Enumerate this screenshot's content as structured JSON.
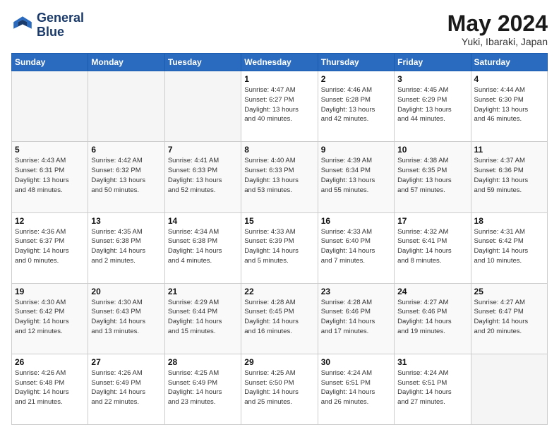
{
  "header": {
    "logo_line1": "General",
    "logo_line2": "Blue",
    "month_title": "May 2024",
    "location": "Yuki, Ibaraki, Japan"
  },
  "weekdays": [
    "Sunday",
    "Monday",
    "Tuesday",
    "Wednesday",
    "Thursday",
    "Friday",
    "Saturday"
  ],
  "weeks": [
    [
      {
        "day": "",
        "info": ""
      },
      {
        "day": "",
        "info": ""
      },
      {
        "day": "",
        "info": ""
      },
      {
        "day": "1",
        "info": "Sunrise: 4:47 AM\nSunset: 6:27 PM\nDaylight: 13 hours\nand 40 minutes."
      },
      {
        "day": "2",
        "info": "Sunrise: 4:46 AM\nSunset: 6:28 PM\nDaylight: 13 hours\nand 42 minutes."
      },
      {
        "day": "3",
        "info": "Sunrise: 4:45 AM\nSunset: 6:29 PM\nDaylight: 13 hours\nand 44 minutes."
      },
      {
        "day": "4",
        "info": "Sunrise: 4:44 AM\nSunset: 6:30 PM\nDaylight: 13 hours\nand 46 minutes."
      }
    ],
    [
      {
        "day": "5",
        "info": "Sunrise: 4:43 AM\nSunset: 6:31 PM\nDaylight: 13 hours\nand 48 minutes."
      },
      {
        "day": "6",
        "info": "Sunrise: 4:42 AM\nSunset: 6:32 PM\nDaylight: 13 hours\nand 50 minutes."
      },
      {
        "day": "7",
        "info": "Sunrise: 4:41 AM\nSunset: 6:33 PM\nDaylight: 13 hours\nand 52 minutes."
      },
      {
        "day": "8",
        "info": "Sunrise: 4:40 AM\nSunset: 6:33 PM\nDaylight: 13 hours\nand 53 minutes."
      },
      {
        "day": "9",
        "info": "Sunrise: 4:39 AM\nSunset: 6:34 PM\nDaylight: 13 hours\nand 55 minutes."
      },
      {
        "day": "10",
        "info": "Sunrise: 4:38 AM\nSunset: 6:35 PM\nDaylight: 13 hours\nand 57 minutes."
      },
      {
        "day": "11",
        "info": "Sunrise: 4:37 AM\nSunset: 6:36 PM\nDaylight: 13 hours\nand 59 minutes."
      }
    ],
    [
      {
        "day": "12",
        "info": "Sunrise: 4:36 AM\nSunset: 6:37 PM\nDaylight: 14 hours\nand 0 minutes."
      },
      {
        "day": "13",
        "info": "Sunrise: 4:35 AM\nSunset: 6:38 PM\nDaylight: 14 hours\nand 2 minutes."
      },
      {
        "day": "14",
        "info": "Sunrise: 4:34 AM\nSunset: 6:38 PM\nDaylight: 14 hours\nand 4 minutes."
      },
      {
        "day": "15",
        "info": "Sunrise: 4:33 AM\nSunset: 6:39 PM\nDaylight: 14 hours\nand 5 minutes."
      },
      {
        "day": "16",
        "info": "Sunrise: 4:33 AM\nSunset: 6:40 PM\nDaylight: 14 hours\nand 7 minutes."
      },
      {
        "day": "17",
        "info": "Sunrise: 4:32 AM\nSunset: 6:41 PM\nDaylight: 14 hours\nand 8 minutes."
      },
      {
        "day": "18",
        "info": "Sunrise: 4:31 AM\nSunset: 6:42 PM\nDaylight: 14 hours\nand 10 minutes."
      }
    ],
    [
      {
        "day": "19",
        "info": "Sunrise: 4:30 AM\nSunset: 6:42 PM\nDaylight: 14 hours\nand 12 minutes."
      },
      {
        "day": "20",
        "info": "Sunrise: 4:30 AM\nSunset: 6:43 PM\nDaylight: 14 hours\nand 13 minutes."
      },
      {
        "day": "21",
        "info": "Sunrise: 4:29 AM\nSunset: 6:44 PM\nDaylight: 14 hours\nand 15 minutes."
      },
      {
        "day": "22",
        "info": "Sunrise: 4:28 AM\nSunset: 6:45 PM\nDaylight: 14 hours\nand 16 minutes."
      },
      {
        "day": "23",
        "info": "Sunrise: 4:28 AM\nSunset: 6:46 PM\nDaylight: 14 hours\nand 17 minutes."
      },
      {
        "day": "24",
        "info": "Sunrise: 4:27 AM\nSunset: 6:46 PM\nDaylight: 14 hours\nand 19 minutes."
      },
      {
        "day": "25",
        "info": "Sunrise: 4:27 AM\nSunset: 6:47 PM\nDaylight: 14 hours\nand 20 minutes."
      }
    ],
    [
      {
        "day": "26",
        "info": "Sunrise: 4:26 AM\nSunset: 6:48 PM\nDaylight: 14 hours\nand 21 minutes."
      },
      {
        "day": "27",
        "info": "Sunrise: 4:26 AM\nSunset: 6:49 PM\nDaylight: 14 hours\nand 22 minutes."
      },
      {
        "day": "28",
        "info": "Sunrise: 4:25 AM\nSunset: 6:49 PM\nDaylight: 14 hours\nand 23 minutes."
      },
      {
        "day": "29",
        "info": "Sunrise: 4:25 AM\nSunset: 6:50 PM\nDaylight: 14 hours\nand 25 minutes."
      },
      {
        "day": "30",
        "info": "Sunrise: 4:24 AM\nSunset: 6:51 PM\nDaylight: 14 hours\nand 26 minutes."
      },
      {
        "day": "31",
        "info": "Sunrise: 4:24 AM\nSunset: 6:51 PM\nDaylight: 14 hours\nand 27 minutes."
      },
      {
        "day": "",
        "info": ""
      }
    ]
  ]
}
